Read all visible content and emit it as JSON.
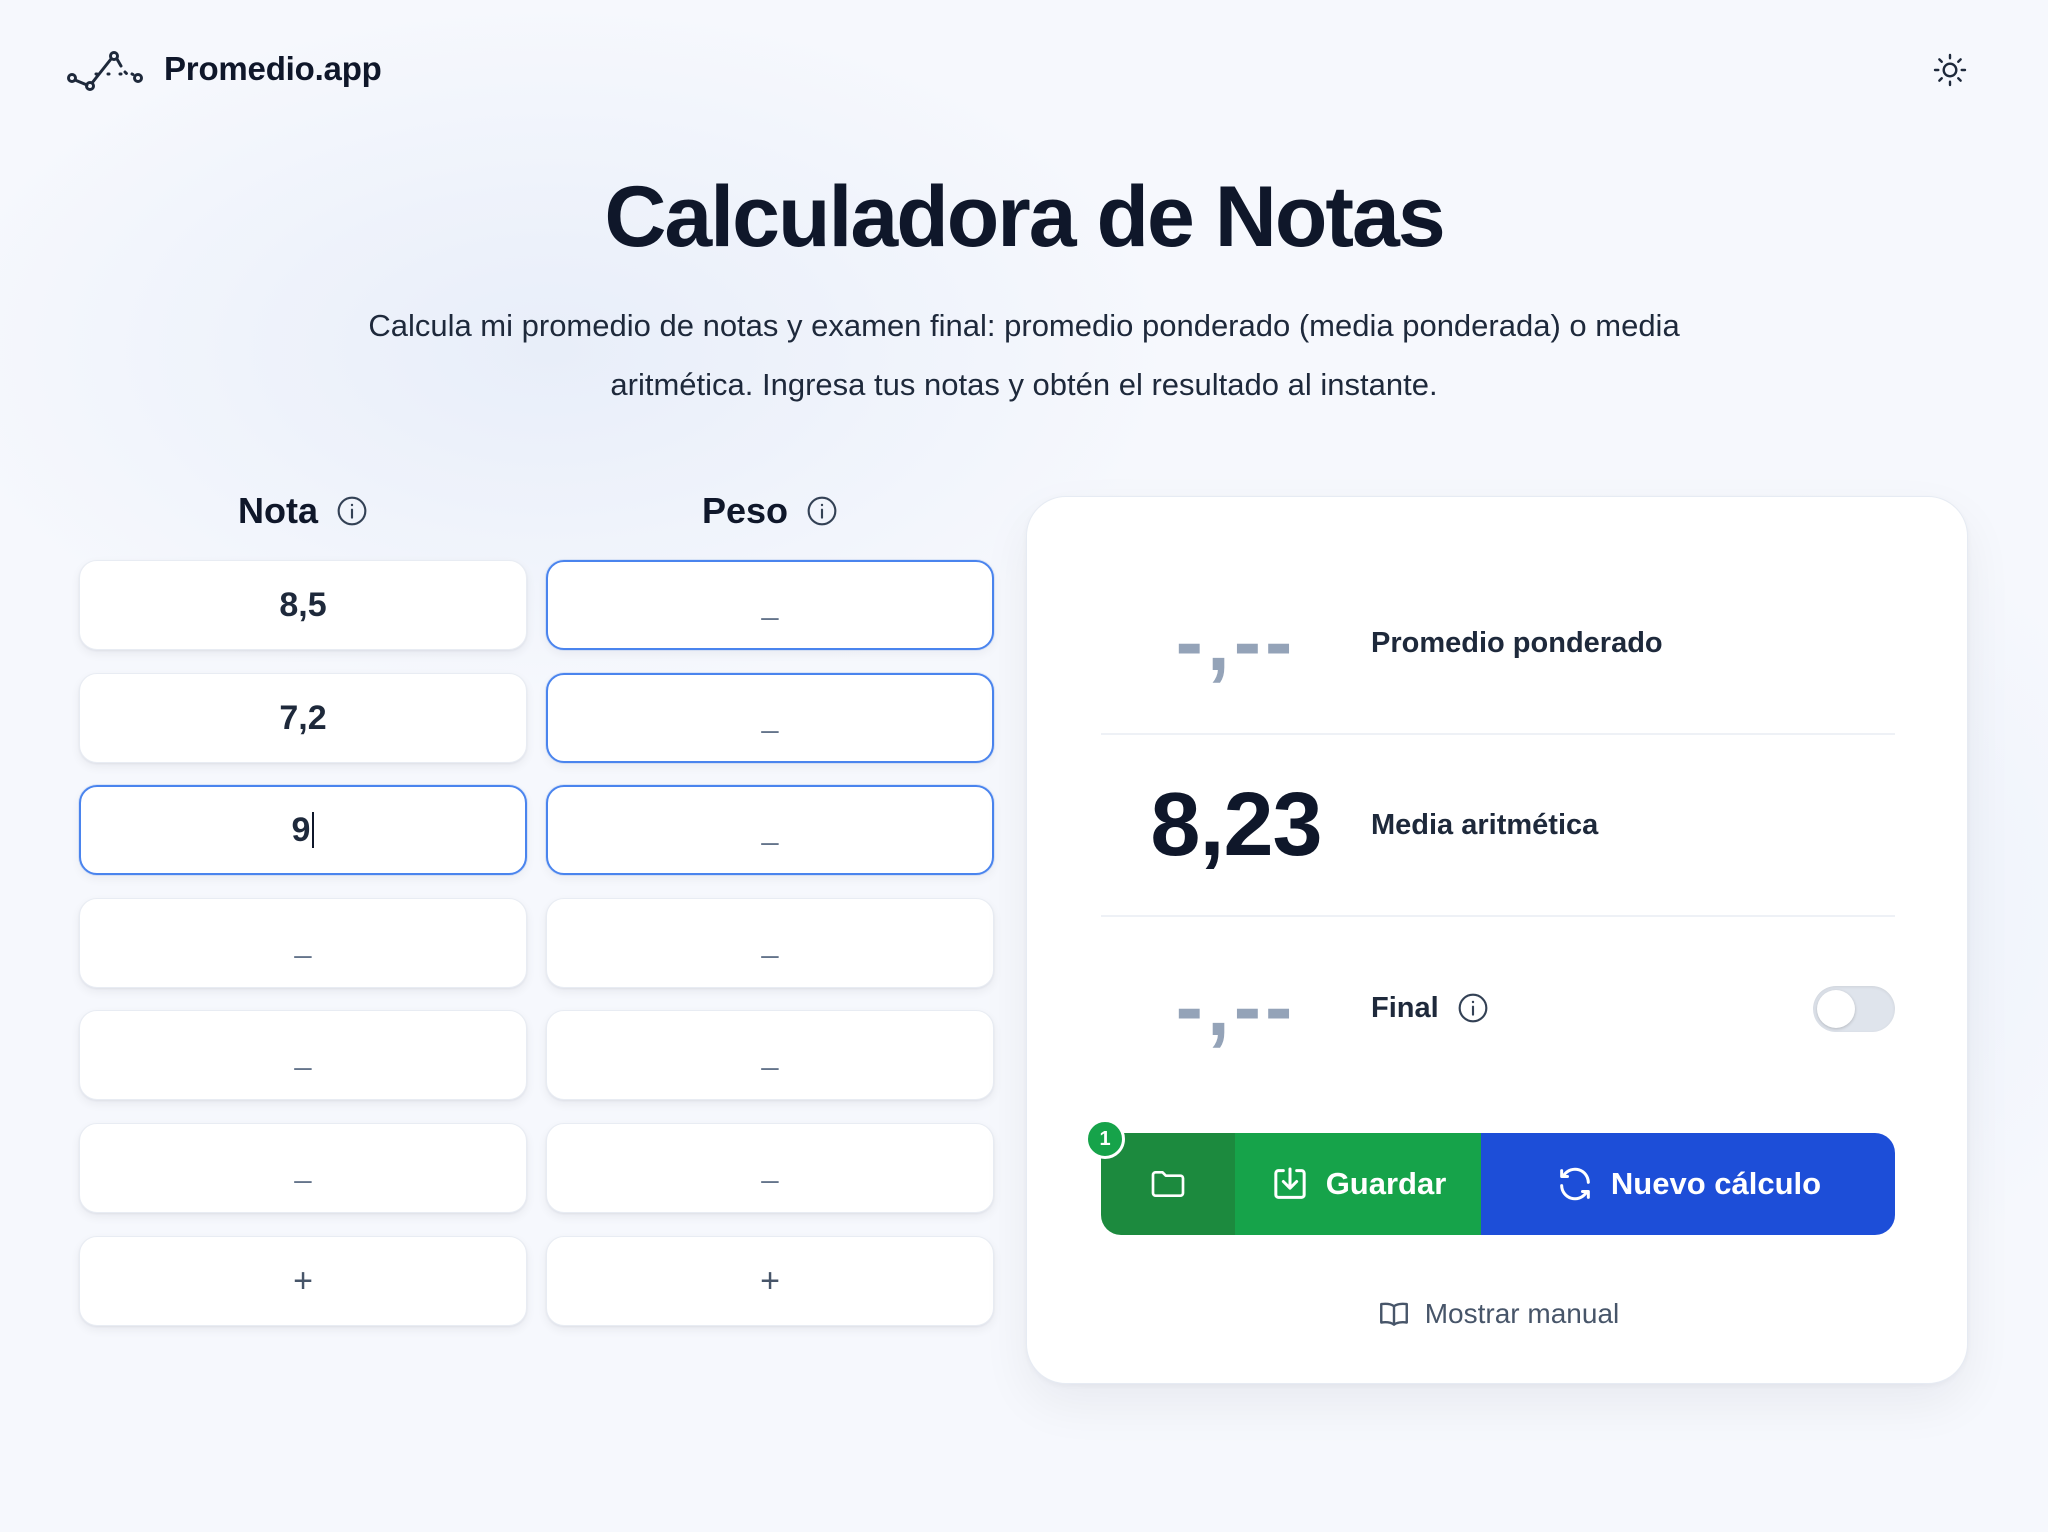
{
  "header": {
    "brand_name": "Promedio.app",
    "logo_icon": "line-chart-icon",
    "theme_icon": "sun-icon"
  },
  "hero": {
    "title": "Calculadora de Notas",
    "subtitle": "Calcula mi promedio de notas y examen final: promedio ponderado (media ponderada) o media aritmética. Ingresa tus notas y obtén el resultado al instante."
  },
  "columns": {
    "nota_label": "Nota",
    "peso_label": "Peso"
  },
  "rows": [
    {
      "nota": "8,5",
      "peso": "_"
    },
    {
      "nota": "7,2",
      "peso": "_"
    },
    {
      "nota": "9",
      "peso": "_"
    },
    {
      "nota": "_",
      "peso": "_"
    },
    {
      "nota": "_",
      "peso": "_"
    },
    {
      "nota": "_",
      "peso": "_"
    }
  ],
  "add_label": "+",
  "results": {
    "weighted_value": "-,--",
    "weighted_label": "Promedio ponderado",
    "arithmetic_value": "8,23",
    "arithmetic_label": "Media aritmética",
    "final_value": "-,--",
    "final_label": "Final",
    "final_enabled": false
  },
  "actions": {
    "saved_count": "1",
    "save_label": "Guardar",
    "new_label": "Nuevo cálculo",
    "manual_label": "Mostrar manual"
  },
  "colors": {
    "green_dark": "#1c8a3e",
    "green": "#16a34a",
    "blue": "#1d4ed8",
    "focus_border": "#4a84ee"
  }
}
